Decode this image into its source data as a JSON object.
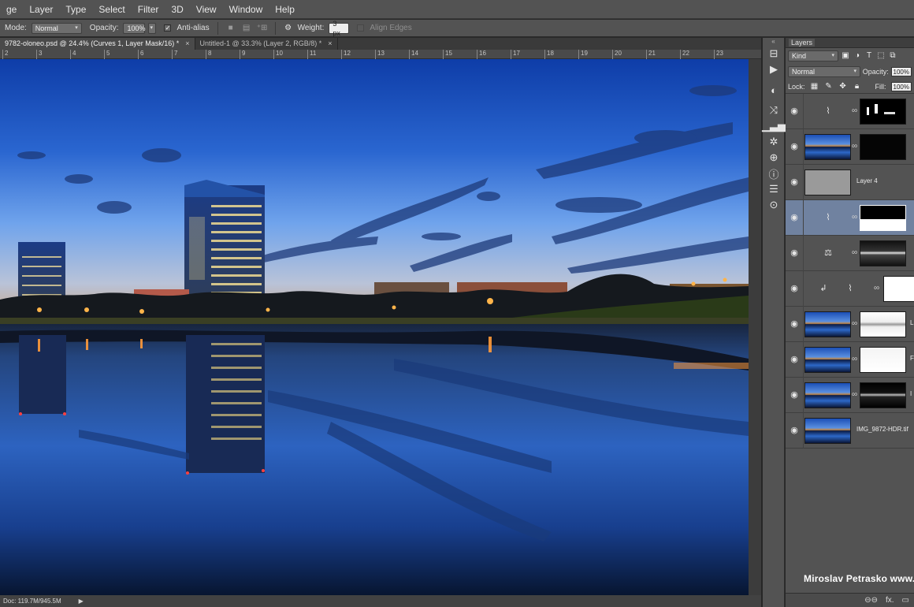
{
  "menu": [
    "ge",
    "Layer",
    "Type",
    "Select",
    "Filter",
    "3D",
    "View",
    "Window",
    "Help"
  ],
  "options": {
    "mode_label": "Mode:",
    "mode_value": "Normal",
    "opacity_label": "Opacity:",
    "opacity_value": "100%",
    "antialias_label": "Anti-alias",
    "antialias_check": "✓",
    "weight_label": "Weight:",
    "weight_value": "3 px",
    "align_label": "Align Edges"
  },
  "tabs": [
    {
      "label": "9782-oloneo.psd @ 24.4% (Curves 1, Layer Mask/16) *",
      "close": "×"
    },
    {
      "label": "Untitled-1 @ 33.3% (Layer 2, RGB/8) *",
      "close": "×"
    }
  ],
  "ruler_ticks": [
    "2",
    "3",
    "4",
    "5",
    "6",
    "7",
    "8",
    "9",
    "10",
    "11",
    "12",
    "13",
    "14",
    "15",
    "16",
    "17",
    "18",
    "19",
    "20",
    "21",
    "22",
    "23"
  ],
  "status": {
    "doc": "Doc: 119.7M/945.5M",
    "arrow": "▶"
  },
  "layers_panel": {
    "collapse": "«",
    "tab": "Layers",
    "kind_label": "Kind",
    "blend_mode": "Normal",
    "opacity_label": "Opacity:",
    "opacity_value": "100%",
    "lock_label": "Lock:",
    "fill_label": "Fill:",
    "fill_value": "100%",
    "layers": [
      {
        "name": "",
        "icon": "curves-icon",
        "eye": "◉"
      },
      {
        "name": "",
        "icon": "",
        "eye": "◉"
      },
      {
        "name": "Layer 4",
        "icon": "",
        "eye": "◉"
      },
      {
        "name": "",
        "icon": "curves-icon",
        "eye": "◉"
      },
      {
        "name": "",
        "icon": "balance-icon",
        "eye": "◉"
      },
      {
        "name": "",
        "icon": "curves-icon",
        "eye": "◉"
      },
      {
        "name": "L",
        "icon": "",
        "eye": "◉"
      },
      {
        "name": "F",
        "icon": "",
        "eye": "◉"
      },
      {
        "name": "I",
        "icon": "",
        "eye": "◉"
      },
      {
        "name": "IMG_9872-HDR.tif",
        "icon": "",
        "eye": "◉"
      }
    ],
    "footer_icons": [
      "⊖⊖",
      "fx.",
      "▭"
    ]
  },
  "watermark": "Miroslav Petrasko www.hdr"
}
